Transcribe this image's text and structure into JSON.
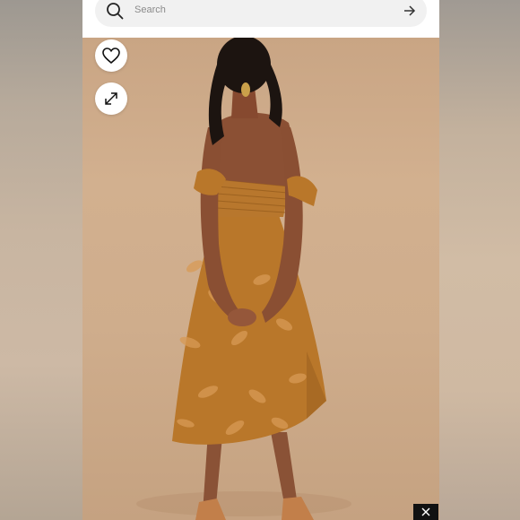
{
  "search": {
    "placeholder": "Search"
  },
  "icons": {
    "search": "search-icon",
    "submit": "arrow-right-icon",
    "like": "heart-icon",
    "expand": "expand-icon",
    "close": "close-icon"
  },
  "colors": {
    "dress": "#b9772a",
    "background": "#d2b08f",
    "search_bar": "#f1f1f1",
    "close_box": "#111111"
  }
}
